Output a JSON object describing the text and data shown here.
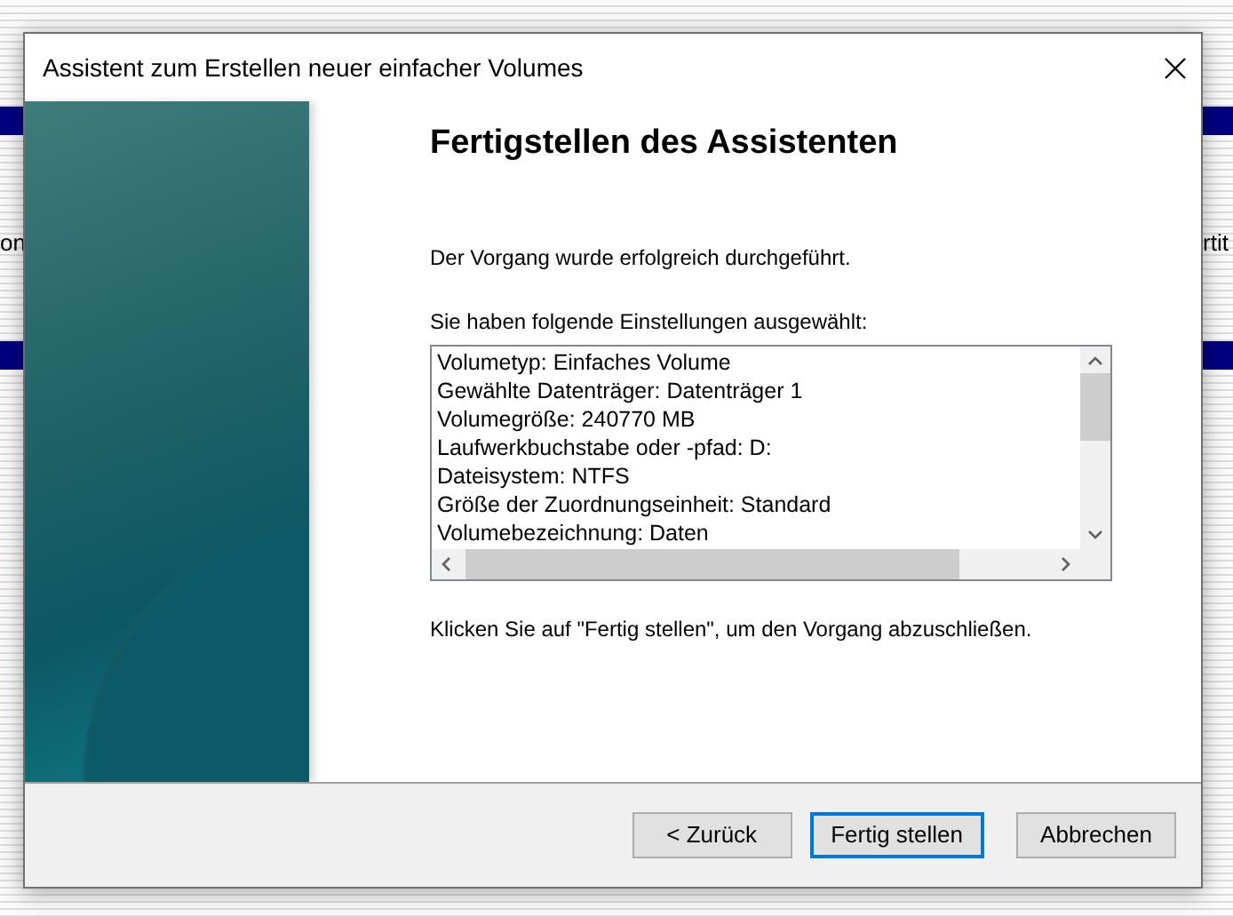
{
  "background_window": {
    "left_fragment": "on",
    "right_fragment": "rtit"
  },
  "window": {
    "title": "Assistent zum Erstellen neuer einfacher Volumes"
  },
  "heading": "Fertigstellen des Assistenten",
  "status_text": "Der Vorgang wurde erfolgreich durchgeführt.",
  "settings_label": "Sie haben folgende Einstellungen ausgewählt:",
  "settings": [
    "Volumetyp: Einfaches Volume",
    "Gewählte Datenträger: Datenträger 1",
    "Volumegröße: 240770 MB",
    "Laufwerkbuchstabe oder -pfad: D:",
    "Dateisystem: NTFS",
    "Größe der Zuordnungseinheit: Standard",
    "Volumebezeichnung: Daten"
  ],
  "instruction": "Klicken Sie auf \"Fertig stellen\", um den Vorgang abzuschließen.",
  "buttons": [
    {
      "label": "< Zurück",
      "default": false
    },
    {
      "label": "Fertig stellen",
      "default": true
    },
    {
      "label": "Abbrechen",
      "default": false
    }
  ]
}
